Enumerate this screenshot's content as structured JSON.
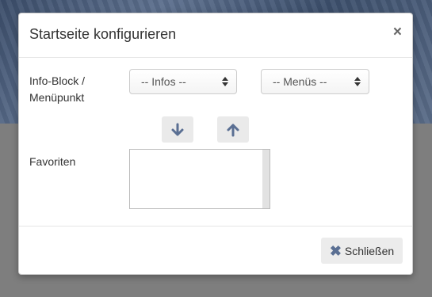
{
  "modal": {
    "title": "Startseite konfigurieren",
    "close_symbol": "×"
  },
  "form": {
    "row1_label_line1": "Info-Block /",
    "row1_label_line2": "Menüpunkt",
    "infos_select_value": "-- Infos --",
    "menus_select_value": "-- Menüs --",
    "favorites_label": "Favoriten"
  },
  "buttons": {
    "move_down_icon": "arrow-down-icon",
    "move_up_icon": "arrow-up-icon",
    "close_label": "Schließen",
    "close_icon_symbol": "✖"
  },
  "colors": {
    "accent": "#5a6f93",
    "button_bg": "#ececec"
  }
}
